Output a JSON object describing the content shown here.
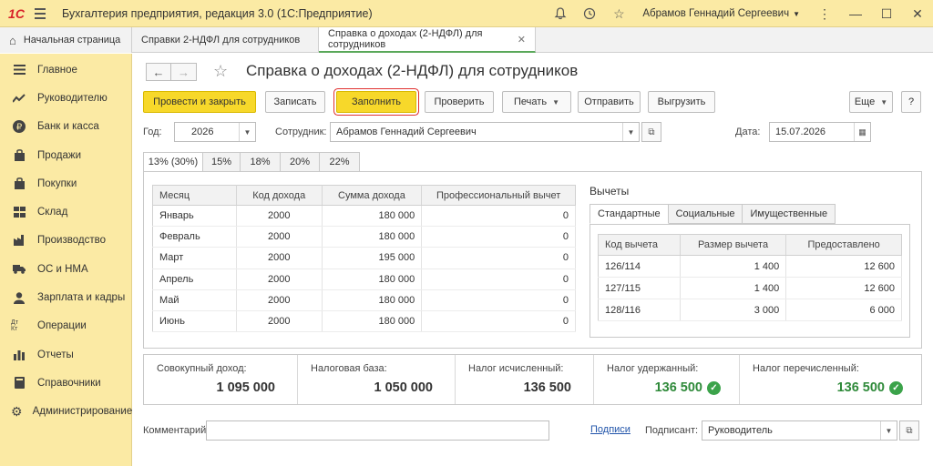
{
  "app": {
    "logo": "1С",
    "title": "Бухгалтерия предприятия, редакция 3.0  (1С:Предприятие)",
    "user": "Абрамов Геннадий Сергеевич"
  },
  "tabs": [
    {
      "label": "Начальная страница"
    },
    {
      "label": "Справки 2-НДФЛ для сотрудников"
    },
    {
      "label": "Справка о доходах (2-НДФЛ) для сотрудников"
    }
  ],
  "sidebar": {
    "items": [
      {
        "label": "Главное",
        "icon": "menu-icon"
      },
      {
        "label": "Руководителю",
        "icon": "trend-icon"
      },
      {
        "label": "Банк и касса",
        "icon": "ruble-icon"
      },
      {
        "label": "Продажи",
        "icon": "cart-icon"
      },
      {
        "label": "Покупки",
        "icon": "bag-icon"
      },
      {
        "label": "Склад",
        "icon": "warehouse-icon"
      },
      {
        "label": "Производство",
        "icon": "factory-icon"
      },
      {
        "label": "ОС и НМА",
        "icon": "truck-icon"
      },
      {
        "label": "Зарплата и кадры",
        "icon": "person-icon"
      },
      {
        "label": "Операции",
        "icon": "dt-kt-icon"
      },
      {
        "label": "Отчеты",
        "icon": "bar-chart-icon"
      },
      {
        "label": "Справочники",
        "icon": "book-icon"
      },
      {
        "label": "Администрирование",
        "icon": "gear-icon"
      }
    ]
  },
  "page": {
    "title": "Справка о доходах (2-НДФЛ) для сотрудников"
  },
  "toolbar": {
    "post_close": "Провести и закрыть",
    "save": "Записать",
    "fill": "Заполнить",
    "check": "Проверить",
    "print": "Печать",
    "send": "Отправить",
    "upload": "Выгрузить",
    "more": "Еще",
    "help": "?"
  },
  "form": {
    "year_label": "Год:",
    "year": "2026",
    "employee_label": "Сотрудник:",
    "employee": "Абрамов Геннадий Сергеевич",
    "date_label": "Дата:",
    "date": "15.07.2026"
  },
  "rate_tabs": [
    "13% (30%)",
    "15%",
    "18%",
    "20%",
    "22%"
  ],
  "income": {
    "headers": [
      "Месяц",
      "Код дохода",
      "Сумма дохода",
      "Профессиональный вычет"
    ],
    "rows": [
      [
        "Январь",
        "2000",
        "180 000",
        "0"
      ],
      [
        "Февраль",
        "2000",
        "180 000",
        "0"
      ],
      [
        "Март",
        "2000",
        "195 000",
        "0"
      ],
      [
        "Апрель",
        "2000",
        "180 000",
        "0"
      ],
      [
        "Май",
        "2000",
        "180 000",
        "0"
      ],
      [
        "Июнь",
        "2000",
        "180 000",
        "0"
      ]
    ]
  },
  "deductions": {
    "title": "Вычеты",
    "tabs": [
      "Стандартные",
      "Социальные",
      "Имущественные"
    ],
    "headers": [
      "Код вычета",
      "Размер вычета",
      "Предоставлено"
    ],
    "rows": [
      [
        "126/114",
        "1 400",
        "12 600"
      ],
      [
        "127/115",
        "1 400",
        "12 600"
      ],
      [
        "128/116",
        "3 000",
        "6 000"
      ]
    ]
  },
  "totals": [
    {
      "label": "Совокупный доход:",
      "value": "1 095 000",
      "ok": false
    },
    {
      "label": "Налоговая база:",
      "value": "1 050 000",
      "ok": false
    },
    {
      "label": "Налог исчисленный:",
      "value": "136 500",
      "ok": false
    },
    {
      "label": "Налог удержанный:",
      "value": "136 500",
      "ok": true
    },
    {
      "label": "Налог перечисленный:",
      "value": "136 500",
      "ok": true
    }
  ],
  "footer": {
    "comment_label": "Комментарий:",
    "comment": "",
    "signatures_link": "Подписи",
    "signer_label": "Подписант:",
    "signer": "Руководитель"
  },
  "colors": {
    "accent_yellow": "#f7d82a",
    "sidebar_bg": "#fbeaa4",
    "ok_green": "#2f8a3a",
    "highlight_red": "#e0312f"
  }
}
